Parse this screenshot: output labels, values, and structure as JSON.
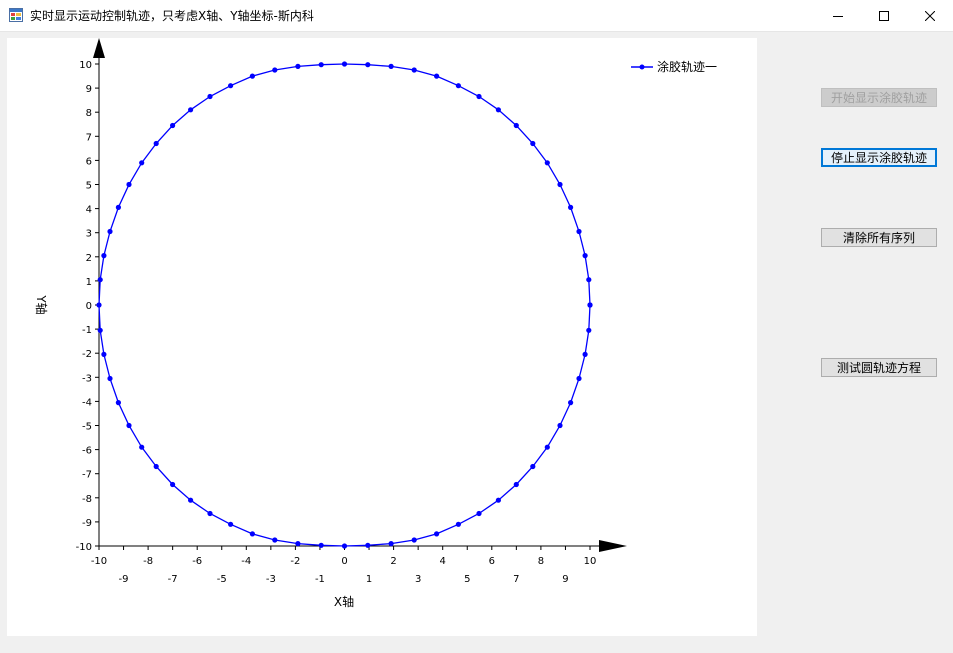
{
  "window": {
    "title": "实时显示运动控制轨迹，只考虑X轴、Y轴坐标-斯内科",
    "icon": "windows-form-icon"
  },
  "controls": {
    "minimize_icon": "minimize-icon",
    "maximize_icon": "maximize-icon",
    "close_icon": "close-icon"
  },
  "buttons": {
    "start": {
      "label": "开始显示涂胶轨迹",
      "enabled": false
    },
    "stop": {
      "label": "停止显示涂胶轨迹",
      "enabled": true,
      "focused": true
    },
    "clear": {
      "label": "清除所有序列",
      "enabled": true
    },
    "test": {
      "label": "测试圆轨迹方程",
      "enabled": true
    }
  },
  "colors": {
    "series": "#0000ff",
    "axis": "#000000",
    "accent": "#0078d7"
  },
  "chart_data": {
    "type": "line",
    "xlabel": "X轴",
    "ylabel": "Y轴",
    "xlim": [
      -10,
      10
    ],
    "ylim": [
      -10,
      10
    ],
    "x_ticks_upper": [
      -10,
      -8,
      -6,
      -4,
      -2,
      0,
      2,
      4,
      6,
      8,
      10
    ],
    "x_ticks_lower": [
      -9,
      -7,
      -5,
      -3,
      -1,
      1,
      3,
      5,
      7,
      9
    ],
    "y_ticks": [
      10,
      9,
      8,
      7,
      6,
      5,
      4,
      3,
      2,
      1,
      0,
      -1,
      -2,
      -3,
      -4,
      -5,
      -6,
      -7,
      -8,
      -9,
      -10
    ],
    "grid": false,
    "legend_position": "top-right",
    "series": [
      {
        "name": "涂胶轨迹一",
        "marker": "circle",
        "x": [
          10,
          9.95,
          9.8,
          9.55,
          9.21,
          8.78,
          8.26,
          7.67,
          7.0,
          6.27,
          5.48,
          4.64,
          3.75,
          2.84,
          1.9,
          0.95,
          0,
          -0.95,
          -1.9,
          -2.84,
          -3.75,
          -4.64,
          -5.48,
          -6.27,
          -7.0,
          -7.67,
          -8.26,
          -8.78,
          -9.21,
          -9.55,
          -9.8,
          -9.95,
          -10,
          -9.95,
          -9.8,
          -9.55,
          -9.21,
          -8.78,
          -8.26,
          -7.67,
          -7.0,
          -6.27,
          -5.48,
          -4.64,
          -3.75,
          -2.84,
          -1.9,
          -0.95,
          0,
          0.95,
          1.9,
          2.84,
          3.75,
          4.64,
          5.48,
          6.27,
          7.0,
          7.67,
          8.26,
          8.78,
          9.21,
          9.55,
          9.8,
          9.95,
          10
        ],
        "y": [
          0,
          1.05,
          2.05,
          3.05,
          4.05,
          5.0,
          5.9,
          6.7,
          7.45,
          8.1,
          8.65,
          9.1,
          9.5,
          9.75,
          9.9,
          9.97,
          10,
          9.97,
          9.9,
          9.75,
          9.5,
          9.1,
          8.65,
          8.1,
          7.45,
          6.7,
          5.9,
          5.0,
          4.05,
          3.05,
          2.05,
          1.05,
          0,
          -1.05,
          -2.05,
          -3.05,
          -4.05,
          -5.0,
          -5.9,
          -6.7,
          -7.45,
          -8.1,
          -8.65,
          -9.1,
          -9.5,
          -9.75,
          -9.9,
          -9.97,
          -10,
          -9.97,
          -9.9,
          -9.75,
          -9.5,
          -9.1,
          -8.65,
          -8.1,
          -7.45,
          -6.7,
          -5.9,
          -5.0,
          -4.05,
          -3.05,
          -2.05,
          -1.05,
          0
        ]
      }
    ]
  }
}
